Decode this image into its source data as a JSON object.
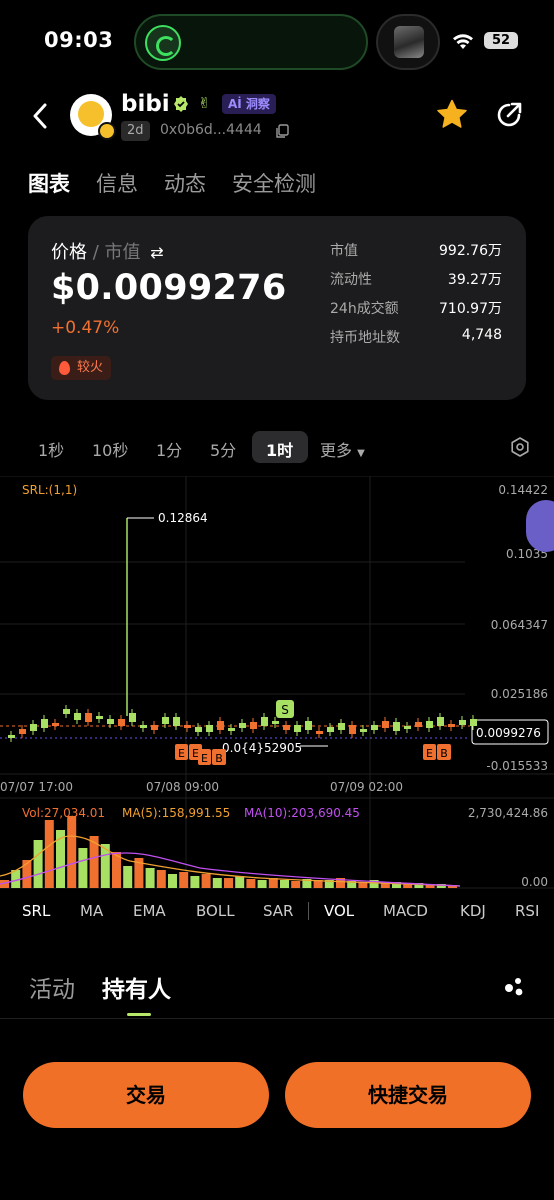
{
  "status_bar": {
    "time": "09:03",
    "battery": "52"
  },
  "header": {
    "token_name": "bibi",
    "ai_tag": "Aİ 洞察",
    "age_tag": "2d",
    "address": "0x0b6d...4444"
  },
  "page_tabs": [
    {
      "label": "图表",
      "active": true
    },
    {
      "label": "信息",
      "active": false
    },
    {
      "label": "动态",
      "active": false
    },
    {
      "label": "安全检测",
      "active": false
    }
  ],
  "price_card": {
    "label_price": "价格",
    "label_sep": " / ",
    "label_mcap": "市值",
    "swap_icon": "⇄",
    "price": "$0.0099276",
    "change": "+0.47%",
    "hot_tag": "较火",
    "stats": [
      {
        "label": "市值",
        "value": "992.76万"
      },
      {
        "label": "流动性",
        "value": "39.27万"
      },
      {
        "label": "24h成交额",
        "value": "710.97万"
      },
      {
        "label": "持币地址数",
        "value": "4,748"
      }
    ]
  },
  "timeframes": {
    "options": [
      "1秒",
      "10秒",
      "1分",
      "5分",
      "1时"
    ],
    "selected": "1时",
    "more_label": "更多"
  },
  "chart_data": {
    "type": "candlestick",
    "indicator_label": "SRL:(1,1)",
    "y_axis_labels": [
      "0.14422",
      "0.1035",
      "0.064347",
      "0.025186",
      "-0.015533"
    ],
    "current_price_label": "0.0099276",
    "max_label": "0.12864",
    "min_label": "0.0{4}52905",
    "x_axis_labels": [
      "07/07 17:00",
      "07/08 09:00",
      "07/09 02:00"
    ],
    "trade_markers": [
      "E",
      "E",
      "E",
      "B",
      "S",
      "E",
      "B"
    ],
    "volume": {
      "vol_label": "Vol:27,034.01",
      "ma5_label": "MA(5):158,991.55",
      "ma10_label": "MA(10):203,690.45",
      "max_label": "2,730,424.86",
      "min_label": "0.00"
    },
    "colors": {
      "up": "#a8e063",
      "down": "#f07030",
      "ma5": "#f0a030",
      "ma10": "#c050f0"
    }
  },
  "indicator_tabs": [
    "SRL",
    "MA",
    "EMA",
    "BOLL",
    "SAR",
    "VOL",
    "MACD",
    "KDJ",
    "RSI"
  ],
  "bottom_tabs": [
    {
      "label": "活动",
      "active": false
    },
    {
      "label": "持有人",
      "active": true
    }
  ],
  "actions": {
    "trade": "交易",
    "quick_trade": "快捷交易"
  }
}
